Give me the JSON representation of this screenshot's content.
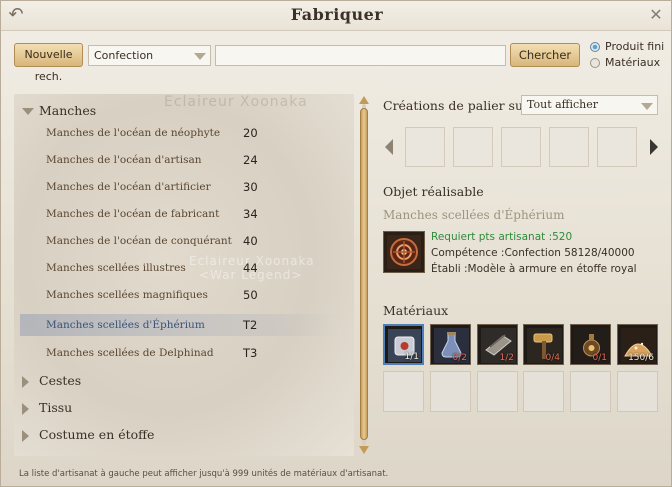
{
  "window": {
    "title": "Fabriquer"
  },
  "toolbar": {
    "new_search_label": "Nouvelle rech.",
    "category_value": "Confection",
    "search_value": "",
    "search_label": "Chercher",
    "radio_finished_label": "Produit fini",
    "radio_materials_label": "Matériaux",
    "radio_selected": "Produit fini"
  },
  "list": {
    "watermark_top": "Eclaireur Xoonaka",
    "watermark_mid": "Eclaireur Xoonaka",
    "watermark_mid2": "<War Legend>",
    "categories": [
      {
        "label": "Manches",
        "expanded": true,
        "items": [
          {
            "label": "Manches de l'océan de néophyte",
            "level": "20"
          },
          {
            "label": "Manches de l'océan d'artisan",
            "level": "24"
          },
          {
            "label": "Manches de l'océan d'artificier",
            "level": "30"
          },
          {
            "label": "Manches de l'océan de fabricant",
            "level": "34"
          },
          {
            "label": "Manches de l'océan de conquérant",
            "level": "40"
          },
          {
            "label": "Manches scellées illustres",
            "level": "44"
          },
          {
            "label": "Manches scellées magnifiques",
            "level": "50"
          },
          {
            "label": "Manches scellées d'Éphérium",
            "level": "T2",
            "selected": true
          },
          {
            "label": "Manches scellées de Delphinad",
            "level": "T3"
          }
        ]
      },
      {
        "label": "Cestes",
        "expanded": false
      },
      {
        "label": "Tissu",
        "expanded": false
      },
      {
        "label": "Costume en étoffe",
        "expanded": false
      }
    ]
  },
  "detail": {
    "upper_tier_title": "Créations de palier sup.",
    "upper_tier_filter": "Tout afficher",
    "craftable_title": "Objet réalisable",
    "item_name": "Manches scellées d'Éphérium",
    "requirement": "Requiert pts artisanat :520",
    "competence": "Compétence :Confection 58128/40000",
    "station": "Établi :Modèle à armure en étoffe royal",
    "materials_title": "Matériaux",
    "materials": [
      {
        "icon": "sealed-armor-icon",
        "count": "1/1",
        "low": false
      },
      {
        "icon": "potion-flask-icon",
        "count": "0/2",
        "low": true
      },
      {
        "icon": "fabric-bolt-icon",
        "count": "1/2",
        "low": true
      },
      {
        "icon": "hammer-icon",
        "count": "0/4",
        "low": true
      },
      {
        "icon": "lantern-icon",
        "count": "0/1",
        "low": true
      },
      {
        "icon": "powder-pile-icon",
        "count": "150/6",
        "low": false
      }
    ]
  },
  "footer": {
    "note": "La liste d'artisanat à gauche peut afficher jusqu'à 999 unités de matériaux d'artisanat."
  },
  "colors": {
    "accent_gold": "#d8b67b",
    "selected_blue": "#4d7fb8",
    "requirement_green": "#2f8a3c",
    "shortage_red": "#e46a55"
  }
}
